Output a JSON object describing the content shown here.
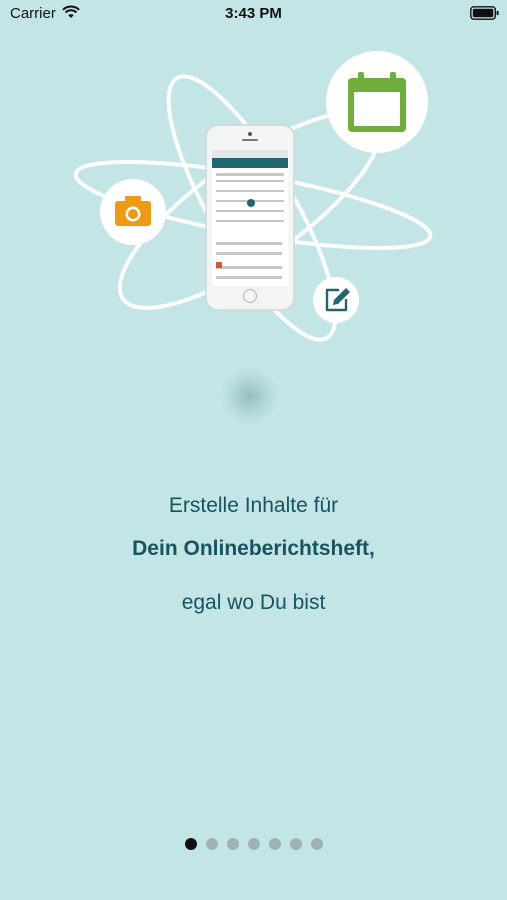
{
  "status_bar": {
    "carrier": "Carrier",
    "time": "3:43 PM"
  },
  "icons": {
    "calendar": "calendar-icon",
    "camera": "camera-icon",
    "edit": "edit-note-icon"
  },
  "colors": {
    "background": "#c4e5e6",
    "text": "#17545f",
    "calendar_green": "#6fae3a",
    "camera_orange": "#ee9a17",
    "edit_teal": "#1f6670",
    "dot_active": "#111111",
    "dot_inactive": "#9fb3b5"
  },
  "content": {
    "line1": "Erstelle Inhalte für",
    "line2": "Dein Onlineberichtsheft,",
    "line3": "egal wo Du bist"
  },
  "pager": {
    "total": 7,
    "current": 1
  }
}
